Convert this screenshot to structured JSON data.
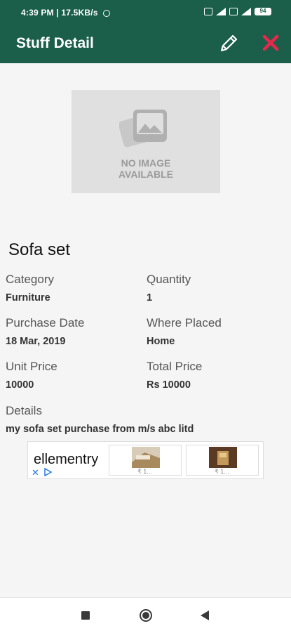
{
  "status_bar": {
    "time": "4:39 PM | 17.5KB/s",
    "battery": "94"
  },
  "app_bar": {
    "title": "Stuff Detail",
    "edit_icon": "pencil-icon",
    "close_icon": "close-icon",
    "close_color": "#e8274b",
    "background": "#1b5e4a"
  },
  "image_placeholder": {
    "line1": "NO IMAGE",
    "line2": "AVAILABLE"
  },
  "item": {
    "name": "Sofa set",
    "fields": {
      "category_label": "Category",
      "category_value": "Furniture",
      "quantity_label": "Quantity",
      "quantity_value": "1",
      "purchase_date_label": "Purchase Date",
      "purchase_date_value": "18 Mar, 2019",
      "where_placed_label": "Where Placed",
      "where_placed_value": "Home",
      "unit_price_label": "Unit Price",
      "unit_price_value": "10000",
      "total_price_label": "Total Price",
      "total_price_value": "Rs 10000",
      "details_label": "Details",
      "details_value": "my sofa set purchase from m/s abc litd"
    }
  },
  "ad": {
    "brand": "ellementry",
    "close": "✕",
    "thumbs": [
      {
        "price": "₹ 1..."
      },
      {
        "price": "₹ 1..."
      }
    ]
  },
  "nav_bar": {
    "recent_icon": "square-icon",
    "home_icon": "circle-icon",
    "back_icon": "triangle-back-icon"
  }
}
